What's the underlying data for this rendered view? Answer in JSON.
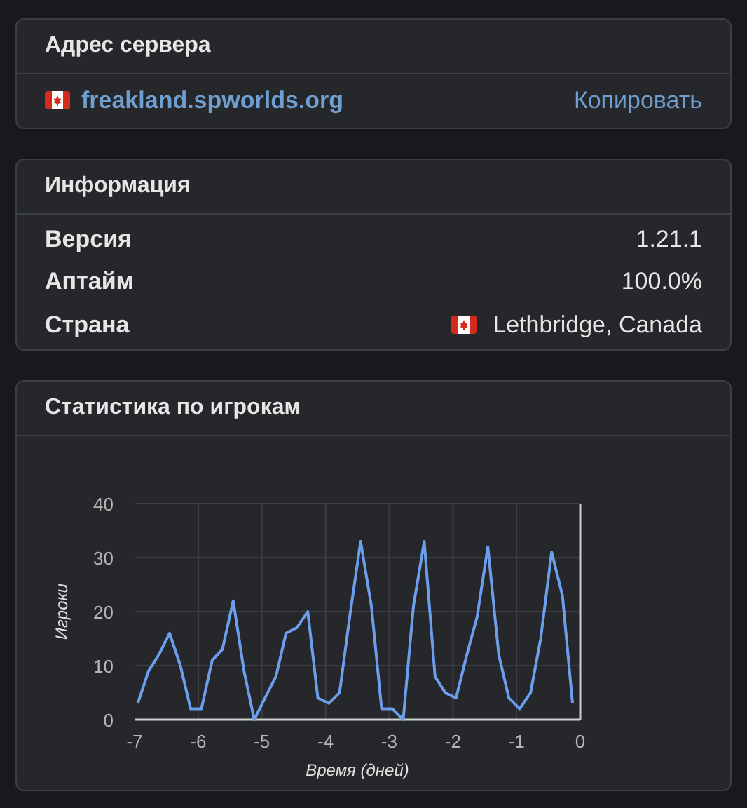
{
  "server_address": {
    "title": "Адрес сервера",
    "address": "freakland.spworlds.org",
    "copy_label": "Копировать"
  },
  "info": {
    "title": "Информация",
    "rows": [
      {
        "label": "Версия",
        "value": "1.21.1",
        "kind": "text"
      },
      {
        "label": "Аптайм",
        "value": "100.0%",
        "kind": "text"
      },
      {
        "label": "Страна",
        "value": "Lethbridge, Canada",
        "kind": "flag"
      }
    ]
  },
  "stats": {
    "title": "Статистика по игрокам",
    "chart_data": {
      "type": "line",
      "xlabel": "Время (дней)",
      "ylabel": "Игроки",
      "x": [
        -6.95,
        -6.78,
        -6.62,
        -6.45,
        -6.28,
        -6.12,
        -5.95,
        -5.78,
        -5.62,
        -5.45,
        -5.28,
        -5.12,
        -4.95,
        -4.78,
        -4.62,
        -4.45,
        -4.28,
        -4.12,
        -3.95,
        -3.78,
        -3.62,
        -3.45,
        -3.28,
        -3.12,
        -2.95,
        -2.78,
        -2.62,
        -2.45,
        -2.28,
        -2.12,
        -1.95,
        -1.78,
        -1.62,
        -1.45,
        -1.28,
        -1.12,
        -0.95,
        -0.78,
        -0.62,
        -0.45,
        -0.28,
        -0.12
      ],
      "grid": true,
      "series": [
        {
          "color": "#6d9eeb",
          "values": [
            3,
            9,
            12,
            16,
            10,
            2,
            2,
            11,
            13,
            22,
            9,
            0,
            4,
            8,
            16,
            17,
            20,
            4,
            3,
            5,
            19,
            33,
            21,
            2,
            2,
            0,
            21,
            33,
            8,
            5,
            4,
            12,
            19,
            32,
            12,
            4,
            2,
            5,
            15,
            31,
            23,
            3
          ]
        }
      ],
      "xlim": [
        -7,
        0
      ],
      "ylim": [
        0,
        40
      ],
      "xticks": [
        -7,
        -6,
        -5,
        -4,
        -3,
        -2,
        -1,
        0
      ],
      "yticks": [
        0,
        10,
        20,
        30,
        40
      ]
    }
  }
}
